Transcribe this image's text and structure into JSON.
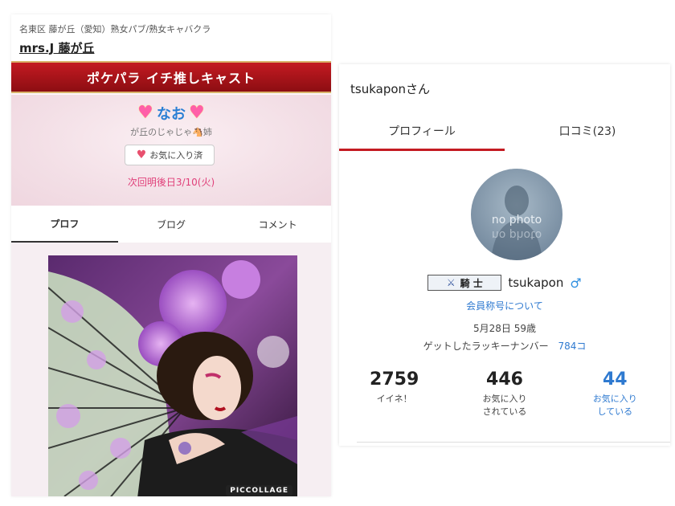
{
  "left": {
    "shop_category": "名東区 藤が丘（愛知）熟女パブ/熟女キャバクラ",
    "shop_name": "mrs.J 藤が丘",
    "banner": "ポケパラ イチ推しキャスト",
    "cast_name": "なお",
    "cast_sub": "が丘のじゃじゃ🐴姉",
    "fav_button": "お気に入り済",
    "next_date": "次回明後日3/10(火)",
    "tabs": [
      "プロフ",
      "ブログ",
      "コメント"
    ],
    "photo_label": "PICCOLLAGE"
  },
  "right": {
    "title": "tsukaponさん",
    "tabs": [
      "プロフィール",
      "口コミ(23)"
    ],
    "avatar_text": "no photo",
    "rank": "騎 士",
    "username": "tsukapon",
    "gender_icon": "♂",
    "member_link": "会員称号について",
    "birthday_age": "5月28日 59歳",
    "lucky_label": "ゲットしたラッキーナンバー",
    "lucky_value": "784コ",
    "stats": [
      {
        "num": "2759",
        "label": "イイネ！"
      },
      {
        "num": "446",
        "label": "お気に入り\nされている"
      },
      {
        "num": "44",
        "label": "お気に入り\nしている"
      }
    ]
  },
  "colors": {
    "banner_red": "#c41b22",
    "link_blue": "#2f7ad0",
    "cast_name_blue": "#2a7fd4",
    "date_pink": "#e0407a"
  },
  "icons": [
    "heart-icon",
    "crossed-swords-icon",
    "male-icon"
  ]
}
